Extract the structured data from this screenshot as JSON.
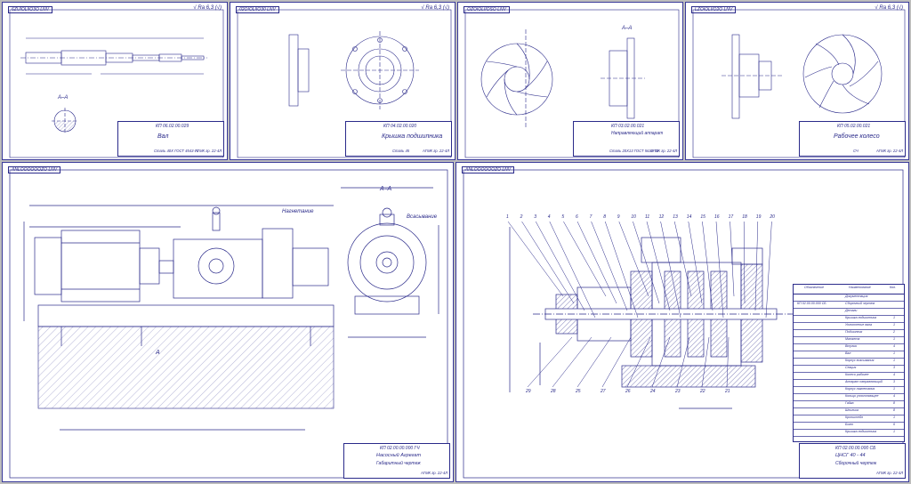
{
  "sheets": {
    "shaft": {
      "code_top": "6ZUIOLIIO3O LNV",
      "roughness": "√ Ra 6,3 (√)",
      "tb_code": "КП 06.02.00.029",
      "tb_name": "Вал",
      "tb_material": "Сталь 40Х ГОСТ 4543-71",
      "tb_group": "АГМК гр. 22-4Л",
      "section_label": "А–А"
    },
    "cover": {
      "code_top": "02OIOLIIO30 LNV",
      "roughness": "√ Ra 6,3 (√)",
      "tb_code": "КП 04.02.00.020",
      "tb_name": "Крышка подшипника",
      "tb_material": "Сталь 45",
      "tb_group": "АГМК гр. 22-4Л"
    },
    "vane": {
      "code_top": "OZOIOLIIOSO LNV",
      "section_label": "А–А",
      "tb_code": "КП 03.02.00.021",
      "tb_name": "Направляющий аппарат",
      "tb_material": "Сталь 20Х13 ГОСТ 5632-72",
      "tb_group": "АГМК гр. 22-4Л"
    },
    "impeller": {
      "code_top": "LZOIOLIIO2O LNV",
      "roughness": "√ Ra 6,3 (√)",
      "tb_code": "КП 05.02.00.021",
      "tb_name": "Рабочее колесо",
      "tb_material": "СЧ",
      "tb_group": "АГМК гр. 22-4Л"
    },
    "unit": {
      "code_top": "ΛNLOOOOOOZO LNV",
      "section_label": "А–А",
      "note1": "Нагнетание",
      "note2": "Всасывание",
      "arrow_label": "А",
      "tb_code": "КП 02.00.00.000 ГЧ",
      "tb_name": "Насосный Агрегат",
      "tb_subname": "Габаритный чертеж",
      "tb_group": "АГМК гр. 22-4Л"
    },
    "assembly": {
      "code_top": "ΛNLOOOOOOZO LNV",
      "tb_code": "КП 02.00.00.000 СБ",
      "tb_name": "ЦНСГ 40 - 44",
      "tb_subname": "Сборочный чертеж",
      "tb_group": "АГМК гр. 22-4Л",
      "balloons_top": [
        "1",
        "2",
        "3",
        "4",
        "5",
        "6",
        "7",
        "8",
        "9",
        "10",
        "11",
        "12",
        "13",
        "14",
        "15",
        "16",
        "17",
        "18",
        "19",
        "20"
      ],
      "balloons_bottom": [
        "29",
        "28",
        "25",
        "27",
        "26",
        "24",
        "23",
        "22",
        "21"
      ],
      "bom_header": [
        "Обозначение",
        "Наименование",
        "Кол."
      ],
      "bom_rows": [
        {
          "desig": "",
          "name": "Документация",
          "qty": ""
        },
        {
          "desig": "КП 02.00.00.000 СБ",
          "name": "Сборочный чертеж",
          "qty": ""
        },
        {
          "desig": "",
          "name": "Детали",
          "qty": ""
        },
        {
          "desig": "",
          "name": "Крышка подшипника",
          "qty": "1"
        },
        {
          "desig": "",
          "name": "Уплотнение вала",
          "qty": "1"
        },
        {
          "desig": "",
          "name": "Подшипник",
          "qty": "2"
        },
        {
          "desig": "",
          "name": "Манжета",
          "qty": "1"
        },
        {
          "desig": "",
          "name": "Втулка",
          "qty": "4"
        },
        {
          "desig": "",
          "name": "Вал",
          "qty": "1"
        },
        {
          "desig": "",
          "name": "Корпус всасывания",
          "qty": "1"
        },
        {
          "desig": "",
          "name": "Секция",
          "qty": "3"
        },
        {
          "desig": "",
          "name": "Колесо рабочее",
          "qty": "4"
        },
        {
          "desig": "",
          "name": "Аппарат направляющий",
          "qty": "3"
        },
        {
          "desig": "",
          "name": "Корпус нагнетания",
          "qty": "1"
        },
        {
          "desig": "",
          "name": "Кольцо уплотняющее",
          "qty": "4"
        },
        {
          "desig": "",
          "name": "Гайка",
          "qty": "8"
        },
        {
          "desig": "",
          "name": "Шпилька",
          "qty": "8"
        },
        {
          "desig": "",
          "name": "Кронштейн",
          "qty": "1"
        },
        {
          "desig": "",
          "name": "Болт",
          "qty": "6"
        },
        {
          "desig": "",
          "name": "Крышка подшипника",
          "qty": "1"
        }
      ]
    }
  },
  "colors": {
    "ink": "#2a2a8a",
    "border": "#3a3a9a",
    "hatch": "#6a6ab0"
  }
}
